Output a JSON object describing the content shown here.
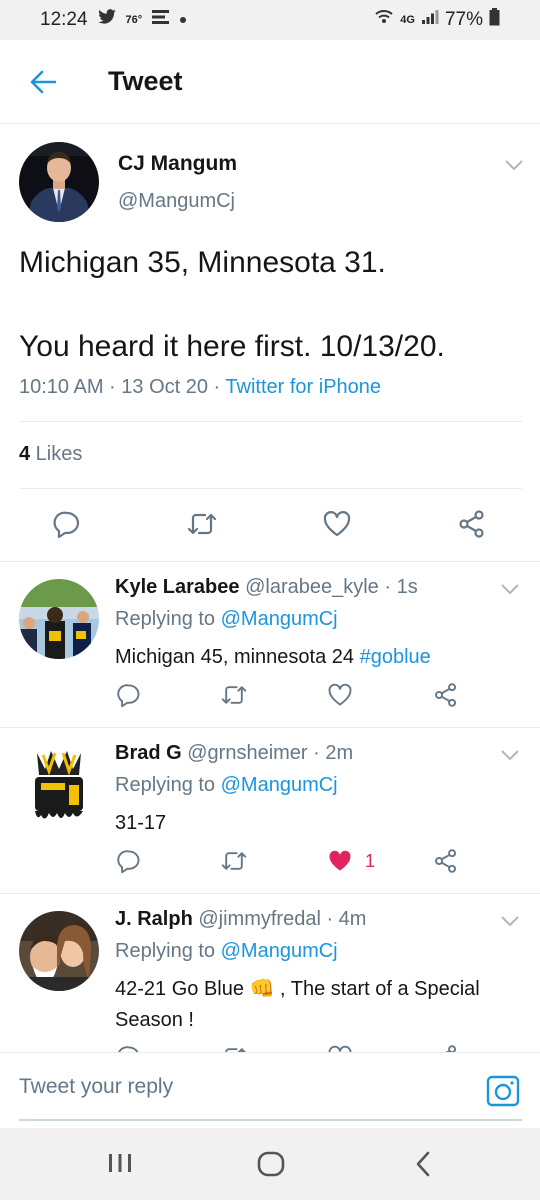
{
  "status_bar": {
    "time": "12:24",
    "temp": "76°",
    "network": "4G",
    "battery": "77%",
    "icons": [
      "twitter-icon",
      "espn-icon",
      "dot-icon",
      "wifi-icon",
      "signal-icon",
      "battery-icon"
    ]
  },
  "header": {
    "title": "Tweet",
    "back_icon": "arrow-left-icon"
  },
  "main_tweet": {
    "name": "CJ Mangum",
    "handle": "@MangumCj",
    "text": "Michigan 35, Minnesota 31.\n\nYou heard it here first. 10/13/20.",
    "time": "10:10 AM · 13 Oct 20 · ",
    "source": "Twitter for iPhone",
    "likes_count": "4",
    "likes_label": " Likes"
  },
  "replies": [
    {
      "name": "Kyle Larabee",
      "handle": "@larabee_kyle",
      "age": " · 1s",
      "replying_label": "Replying to ",
      "replying_to": "@MangumCj",
      "text": "Michigan 45, minnesota 24 ",
      "hashtag": "#goblue",
      "likes": ""
    },
    {
      "name": "Brad G",
      "handle": "@grnsheimer",
      "age": " · 2m",
      "replying_label": "Replying to ",
      "replying_to": "@MangumCj",
      "text": "31-17",
      "likes": "1",
      "liked": true
    },
    {
      "name": "J. Ralph",
      "handle": "@jimmyfredal",
      "age": " · 4m",
      "replying_label": "Replying to ",
      "replying_to": "@MangumCj",
      "text_before": "42-21 Go Blue ",
      "emoji": "👊",
      "text_after": " , The start of a Special Season !"
    }
  ],
  "reply_box": {
    "placeholder": "Tweet your reply",
    "camera_icon": "camera-icon"
  },
  "colors": {
    "accent": "#1b95e0",
    "like_red": "#e0245e",
    "muted": "#657786",
    "text": "#14171a"
  }
}
